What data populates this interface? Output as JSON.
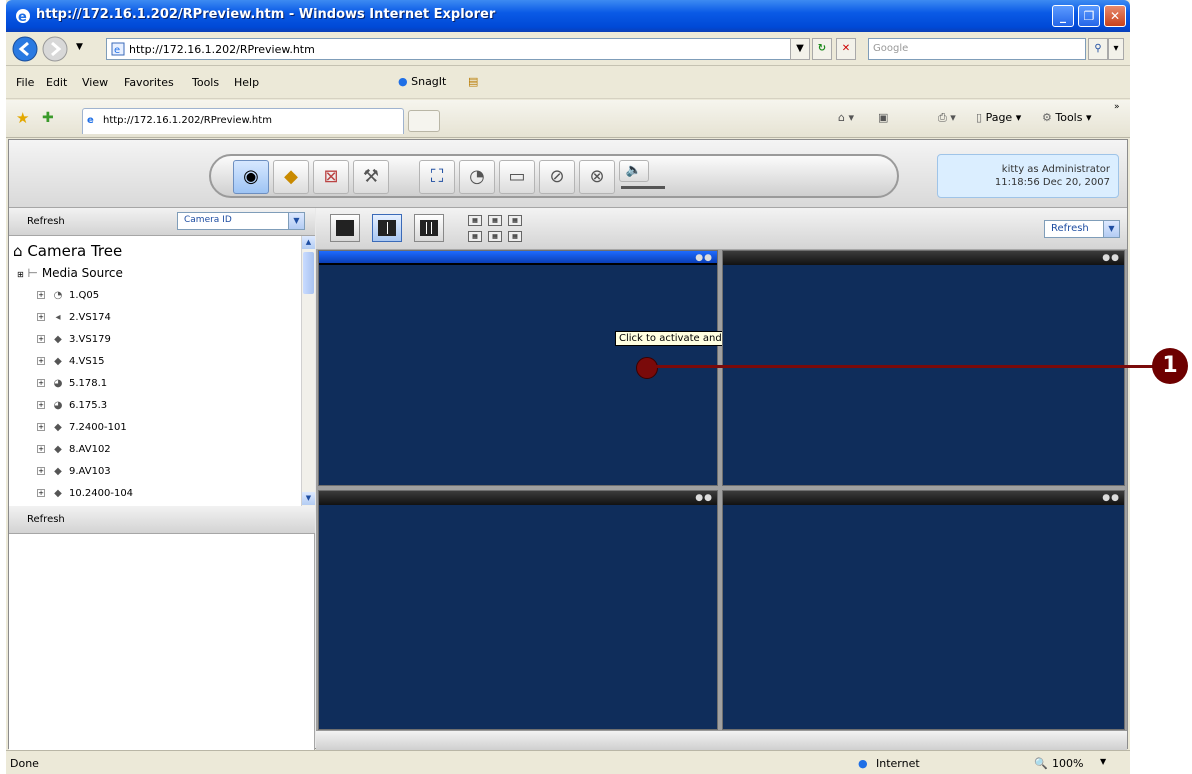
{
  "window": {
    "title": "http://172.16.1.202/RPreview.htm - Windows Internet Explorer"
  },
  "address": {
    "url": "http://172.16.1.202/RPreview.htm",
    "search_placeholder": "Google"
  },
  "menu": [
    "File",
    "Edit",
    "View",
    "Favorites",
    "Tools",
    "Help"
  ],
  "snagit": "SnagIt",
  "tab": {
    "label": "http://172.16.1.202/RPreview.htm"
  },
  "commands": {
    "page": "Page",
    "tools": "Tools"
  },
  "user": {
    "line1": "kitty as Administrator",
    "line2": "11:18:56 Dec 20, 2007"
  },
  "left": {
    "refresh_top": "Refresh",
    "select_value": "Camera ID",
    "tree_root": "Camera Tree",
    "media_source": "Media Source",
    "cameras": [
      "1.Q05",
      "2.VS174",
      "3.VS179",
      "4.VS15",
      "5.178.1",
      "6.175.3",
      "7.2400-101",
      "8.AV102",
      "9.AV103",
      "10.2400-104"
    ],
    "refresh_bottom": "Refresh"
  },
  "main": {
    "refresh_select": "Refresh",
    "tooltip": "Click to activate and use this control"
  },
  "status": {
    "left": "Done",
    "zone": "Internet",
    "zoom": "100%"
  },
  "callout": "1",
  "colors": {
    "video_bg": "#0f2d5b",
    "titlebar": "#0a5ae6",
    "callout": "#6e0000"
  }
}
